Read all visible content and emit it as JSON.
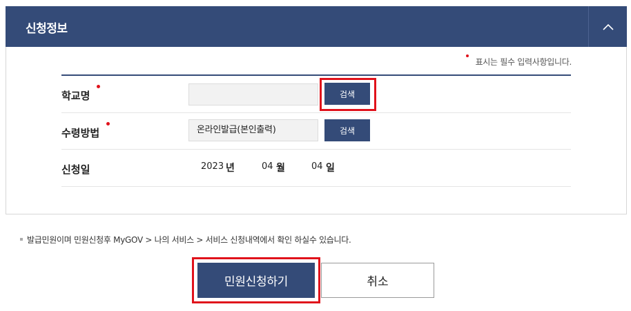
{
  "panel": {
    "title": "신청정보",
    "collapse_icon": "chevron-up-icon"
  },
  "required_note": "표시는 필수 입력사항입니다.",
  "form": {
    "school": {
      "label": "학교명",
      "value": "",
      "search_label": "검색"
    },
    "method": {
      "label": "수령방법",
      "value": "온라인발급(본인출력)",
      "search_label": "검색"
    },
    "date": {
      "label": "신청일",
      "year": "2023",
      "year_unit": "년",
      "month": "04",
      "month_unit": "월",
      "day": "04",
      "day_unit": "일"
    }
  },
  "info_text": "발급민원이며 민원신청후 MyGOV > 나의 서비스 > 서비스 신청내역에서 확인 하실수 있습니다.",
  "buttons": {
    "submit": "민원신청하기",
    "cancel": "취소"
  },
  "colors": {
    "primary": "#344b78",
    "required": "#e0121b",
    "highlight": "#e0121b"
  }
}
